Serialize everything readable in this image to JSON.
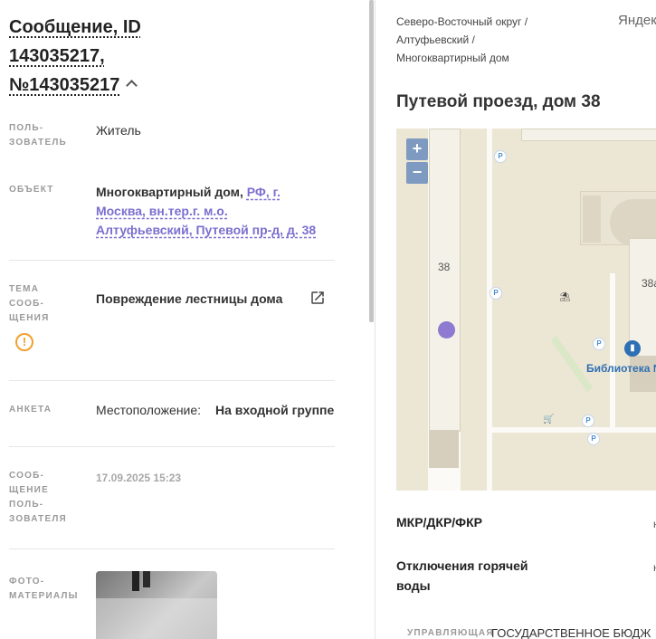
{
  "message": {
    "title_line1": "Сообщение, ID",
    "title_line2": "143035217,",
    "title_line3": "№143035217"
  },
  "fields": {
    "user_label_1": "ПОЛЬ-",
    "user_label_2": "ЗОВАТЕЛЬ",
    "user_value": "Житель",
    "object_label": "ОБЪЕКТ",
    "object_prefix": "Многоквартирный дом,",
    "object_link": "РФ, г. Москва, вн.тер.г. м.о. Алтуфьевский, Путевой пр-д, д. 38",
    "topic_label_1": "ТЕМА",
    "topic_label_2": "СООБ-",
    "topic_label_3": "ЩЕНИЯ",
    "topic_value": "Повреждение лестницы дома",
    "survey_label": "АНКЕТА",
    "survey_key": "Местоположение:",
    "survey_value": "На входной группе",
    "usermsg_label_1": "СООБ-",
    "usermsg_label_2": "ЩЕНИЕ",
    "usermsg_label_3": "ПОЛЬ-",
    "usermsg_label_4": "ЗОВАТЕЛЯ",
    "usermsg_value": "17.09.2025 15:23",
    "photo_label_1": "ФОТО-",
    "photo_label_2": "МАТЕРИАЛЫ"
  },
  "right": {
    "crumb_1": "Северо-Восточный округ /",
    "crumb_2": "Алтуфьевский /",
    "crumb_3": "Многоквартирный дом",
    "yandex": "Яндекс",
    "address": "Путевой проезд, дом 38",
    "row1_label": "МКР/ДКР/ФКР",
    "row1_value": "н",
    "row2_label": "Отключения горячей воды",
    "row2_value": "н",
    "mgmt_label": "УПРАВЛЯЮЩАЯ",
    "mgmt_value": "ГОСУДАРСТВЕННОЕ БЮДЖ"
  },
  "map": {
    "zoom_in": "+",
    "zoom_out": "−",
    "building_38": "38",
    "building_38a": "38а",
    "library": "Библиотека №",
    "parking": "P"
  },
  "colors": {
    "accent": "#7b6fcf",
    "warning": "#f0a030",
    "map_bg": "#ece6d4"
  }
}
